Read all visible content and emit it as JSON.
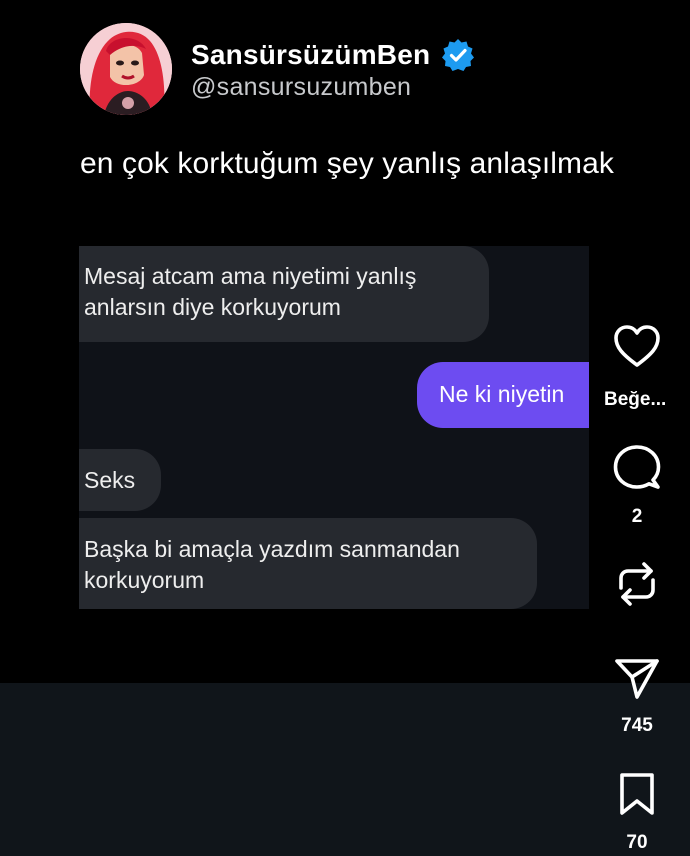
{
  "post": {
    "display_name": "SansürsüzümBen",
    "handle": "@sansursuzumben",
    "verified_icon": "verified-badge-icon",
    "text": "en çok korktuğum şey yanlış anlaşılmak"
  },
  "chat": {
    "messages": [
      {
        "direction": "incoming",
        "text_line1": "Mesaj atcam ama niyetimi yanlış",
        "text_line2": "anlarsın diye korkuyorum"
      },
      {
        "direction": "outgoing",
        "text_line1": "Ne ki niyetin"
      },
      {
        "direction": "incoming",
        "text_line1": "Seks"
      },
      {
        "direction": "incoming",
        "text_line1": "Başka bi amaçla yazdım sanmandan",
        "text_line2": "korkuyorum"
      }
    ],
    "colors": {
      "incoming_bubble": "#26292f",
      "outgoing_bubble": "#6d4cf1",
      "background": "#0f1218"
    }
  },
  "actions": {
    "like": {
      "icon": "heart-icon",
      "label": "Beğe..."
    },
    "comment": {
      "icon": "comment-icon",
      "count": "2"
    },
    "repost": {
      "icon": "repost-icon"
    },
    "share": {
      "icon": "send-icon",
      "count": "745"
    },
    "save": {
      "icon": "bookmark-icon",
      "count": "70"
    }
  },
  "theme": {
    "background": "#000000",
    "accent_verified": "#1d9bf0"
  }
}
